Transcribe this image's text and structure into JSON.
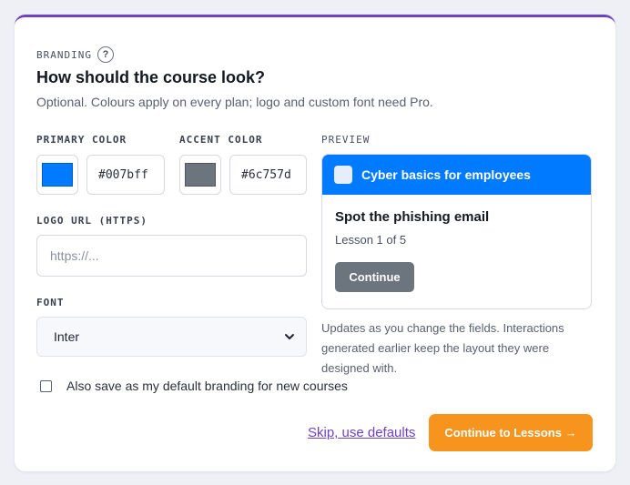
{
  "section": {
    "label": "BRANDING",
    "help_icon": "?"
  },
  "title": "How should the course look?",
  "subtitle": "Optional. Colours apply on every plan; logo and custom font need Pro.",
  "primary_color": {
    "label": "PRIMARY COLOR",
    "value": "#007bff"
  },
  "accent_color": {
    "label": "ACCENT COLOR",
    "value": "#6c757d"
  },
  "logo_url": {
    "label": "LOGO URL (HTTPS)",
    "placeholder": "https://...",
    "value": ""
  },
  "font": {
    "label": "FONT",
    "selected": "Inter"
  },
  "preview": {
    "label": "PREVIEW",
    "course_title": "Cyber basics for employees",
    "lesson_title": "Spot the phishing email",
    "lesson_count": "Lesson 1 of 5",
    "button_label": "Continue",
    "note": "Updates as you change the fields. Interactions generated earlier keep the layout they were designed with."
  },
  "default_branding": {
    "label": "Also save as my default branding for new courses",
    "checked": false
  },
  "actions": {
    "skip_label": "Skip, use defaults",
    "continue_label": "Continue to Lessons →"
  },
  "colors": {
    "brand_purple": "#6f42c1",
    "cta_orange": "#f7941d"
  }
}
